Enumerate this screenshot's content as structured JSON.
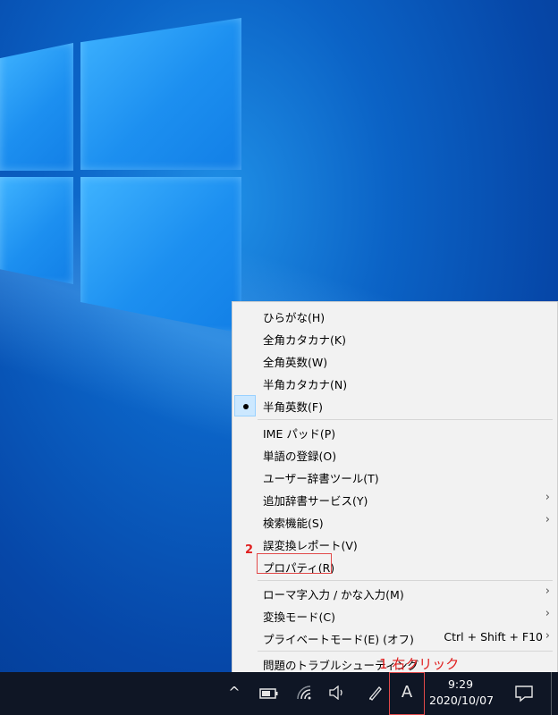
{
  "desktop": {
    "background": "windows-10-hero"
  },
  "menu": {
    "items": [
      {
        "label": "ひらがな(H)"
      },
      {
        "label": "全角カタカナ(K)"
      },
      {
        "label": "全角英数(W)"
      },
      {
        "label": "半角カタカナ(N)"
      },
      {
        "label": "半角英数(F)",
        "checked": true
      },
      {
        "label": "IME パッド(P)"
      },
      {
        "label": "単語の登録(O)"
      },
      {
        "label": "ユーザー辞書ツール(T)"
      },
      {
        "label": "追加辞書サービス(Y)",
        "submenu_glyph": "›"
      },
      {
        "label": "検索機能(S)",
        "submenu_glyph": "›"
      },
      {
        "label": "誤変換レポート(V)"
      },
      {
        "label": "プロパティ(R)"
      },
      {
        "label": "ローマ字入力 / かな入力(M)",
        "submenu_glyph": "›"
      },
      {
        "label": "変換モード(C)",
        "submenu_glyph": "›"
      },
      {
        "label": "プライベートモード(E) (オフ)",
        "shortcut": "Ctrl + Shift + F10",
        "submenu_glyph": "›"
      },
      {
        "label": "問題のトラブルシューティング"
      }
    ]
  },
  "annotations": {
    "step1": "1 右クリック",
    "step2": "2"
  },
  "taskbar": {
    "tray_expand_glyph": "^",
    "ime_indicator": "A",
    "time": "9:29",
    "date": "2020/10/07"
  },
  "colors": {
    "accent": "#e24a4a",
    "menu_bg": "#f2f2f2",
    "taskbar_bg": "#0f1625",
    "checked_bg": "#cce8ff"
  }
}
